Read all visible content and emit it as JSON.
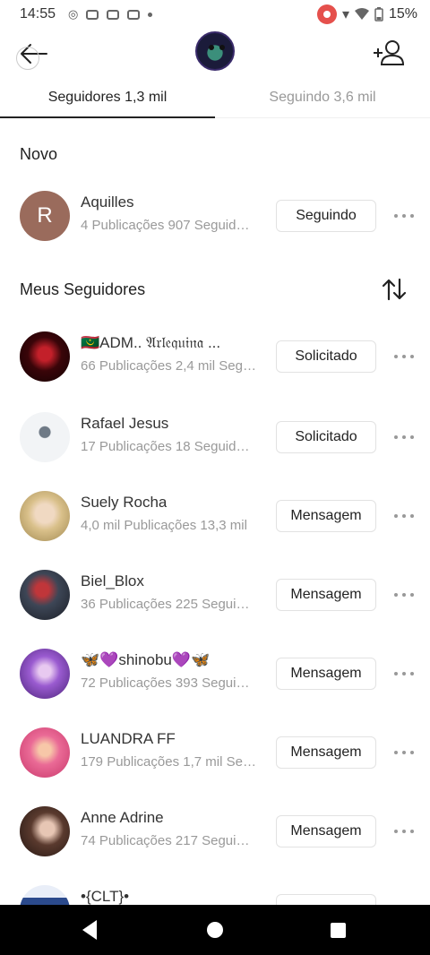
{
  "status_bar": {
    "time": "14:55",
    "battery": "15%",
    "icons": [
      "signal-app-icon",
      "discord-icon",
      "discord-icon",
      "discord-icon",
      "notification-dot",
      "screen-record-icon",
      "wifi-icon",
      "battery-icon"
    ]
  },
  "tabs": [
    {
      "label": "Seguidores 1,3 mil",
      "active": true
    },
    {
      "label": "Seguindo 3,6 mil",
      "active": false
    }
  ],
  "sections": {
    "new_title": "Novo",
    "followers_title": "Meus Seguidores"
  },
  "new_followers": [
    {
      "name": "Aquilles",
      "stats": "4 Publicações   907 Seguidores",
      "button": "Seguindo",
      "avatar_letter": "R",
      "avatar_color": "#9a6b5c"
    }
  ],
  "followers": [
    {
      "name": "🇲🇷ADM.. 𝔄𝔯𝔩𝔢𝔮𝔲𝔦𝔫𝔞 ...",
      "stats": "66 Publicações   2,4 mil Seguidores",
      "button": "Solicitado",
      "avatar_color": "#5a0d12"
    },
    {
      "name": "Rafael Jesus",
      "stats": "17 Publicações   18 Seguidores",
      "button": "Solicitado",
      "avatar_color": "#eef0f3"
    },
    {
      "name": "Suely Rocha",
      "stats": "4,0 mil Publicações   13,3 mil",
      "button": "Mensagem",
      "avatar_color": "#d8c39a"
    },
    {
      "name": "Biel_Blox",
      "stats": "36 Publicações   225 Seguidores",
      "button": "Mensagem",
      "avatar_color": "#3b3b4a"
    },
    {
      "name": "🦋💜shinobu💜🦋",
      "stats": "72 Publicações   393 Seguidores",
      "button": "Mensagem",
      "avatar_color": "#7a4fb8"
    },
    {
      "name": "LUANDRA FF",
      "stats": "179 Publicações   1,7 mil Seguidores",
      "button": "Mensagem",
      "avatar_color": "#e05a86"
    },
    {
      "name": "Anne Adrine",
      "stats": "74 Publicações   217 Seguidores",
      "button": "Mensagem",
      "avatar_color": "#6b4a3c"
    },
    {
      "name": "•{CLT}•",
      "stats": "",
      "button": "",
      "avatar_color": "#2b4a8c"
    }
  ]
}
